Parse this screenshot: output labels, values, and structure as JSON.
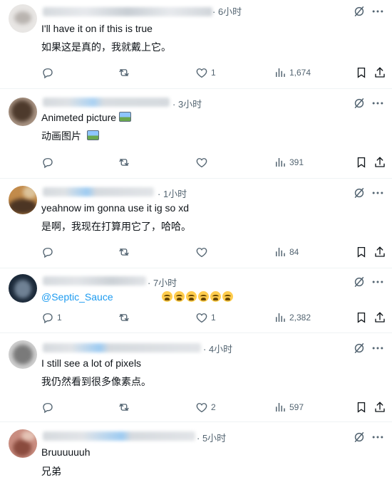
{
  "tweets": [
    {
      "time": "· 6小时",
      "text": "I'll have it on if this is true",
      "translation": "如果这是真的，我就戴上它。",
      "replies": "",
      "likes": "1",
      "views": "1,674"
    },
    {
      "time": "· 3小时",
      "text": "Animeted picture",
      "translation": "动画图片",
      "replies": "",
      "likes": "",
      "views": "391"
    },
    {
      "time": "· 1小时",
      "text": "yeahnow im gonna use it ig so xd",
      "translation": "是啊，我现在打算用它了，哈哈。",
      "replies": "",
      "likes": "",
      "views": "84"
    },
    {
      "time": "· 7小时",
      "mention": "@Septic_Sauce",
      "replies": "1",
      "likes": "1",
      "views": "2,382"
    },
    {
      "time": "· 4小时",
      "text": "I still see a lot of pixels",
      "translation": "我仍然看到很多像素点。",
      "replies": "",
      "likes": "2",
      "views": "597"
    },
    {
      "time": "· 5小时",
      "text": "Bruuuuuuh",
      "translation": "兄弟"
    }
  ],
  "icons": {
    "reply": "reply-icon",
    "retweet": "retweet-icon",
    "like": "heart-icon",
    "views": "views-icon",
    "bookmark": "bookmark-icon",
    "share": "share-icon",
    "grok": "grok-icon",
    "more": "more-icon",
    "emoji": "loudly-crying-face-emoji",
    "picture": "framed-picture-emoji"
  },
  "colors": {
    "link": "#1d9bf0",
    "secondary": "#536471",
    "divider": "#eff3f4"
  }
}
